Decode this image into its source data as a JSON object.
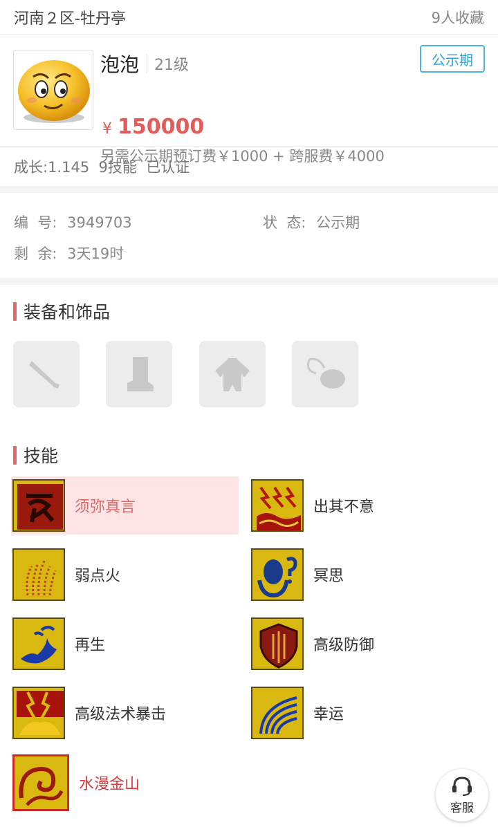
{
  "header": {
    "server": "河南２区-牡丹亭",
    "favorites": "9人收藏"
  },
  "pet": {
    "name": "泡泡",
    "level": "21级",
    "badge": "公示期",
    "currency": "¥",
    "price": "150000",
    "fees": "另需公示期预订费￥1000 + 跨服费￥4000",
    "summary": "成长:1.145  9技能  已认证"
  },
  "info": {
    "id_label": "编  号:",
    "id_value": "3949703",
    "status_label": "状  态:",
    "status_value": "公示期",
    "remain_label": "剩  余:",
    "remain_value": "3天19时"
  },
  "equipment": {
    "title": "装备和饰品",
    "slots": [
      "weapon-icon",
      "boot-icon",
      "armor-icon",
      "pendant-icon"
    ]
  },
  "skills": {
    "title": "技能",
    "items": [
      {
        "name": "须弥真言",
        "icon": "sumeru-mantra-icon",
        "state": "selected"
      },
      {
        "name": "出其不意",
        "icon": "surprise-attack-icon"
      },
      {
        "name": "弱点火",
        "icon": "fire-weakness-icon"
      },
      {
        "name": "冥思",
        "icon": "meditation-icon"
      },
      {
        "name": "再生",
        "icon": "regeneration-icon"
      },
      {
        "name": "高级防御",
        "icon": "advanced-defense-icon"
      },
      {
        "name": "高级法术暴击",
        "icon": "advanced-magic-crit-icon"
      },
      {
        "name": "幸运",
        "icon": "luck-icon"
      },
      {
        "name": "水漫金山",
        "icon": "flood-golden-mountain-icon",
        "state": "special"
      }
    ]
  },
  "service": {
    "label": "客服"
  },
  "colors": {
    "accent_red": "#e25c5c",
    "badge_blue": "#2fa3d6",
    "skill_gold": "#d9c21a"
  }
}
